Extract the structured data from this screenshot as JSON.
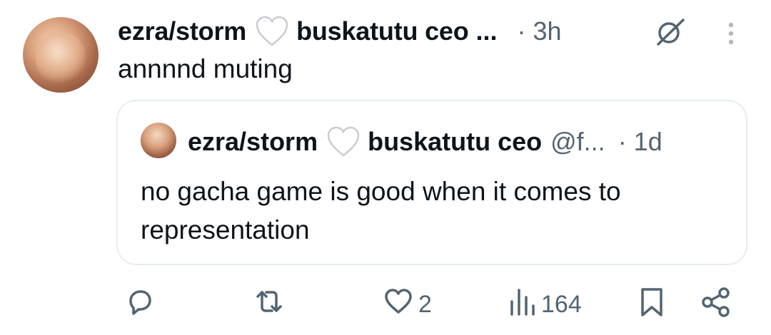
{
  "post": {
    "display_name": "ezra/storm",
    "name_suffix": "buskatutu ceo",
    "ellipsis": "...",
    "time": "· 3h",
    "text": "annnnd muting"
  },
  "quoted_post": {
    "display_name": "ezra/storm",
    "name_suffix": "buskatutu ceo",
    "handle": "@f...",
    "time": "· 1d",
    "text_line1": "no gacha game is good when it comes to",
    "text_line2": "representation"
  },
  "actions": {
    "reply_count": "",
    "repost_count": "",
    "like_count": "2",
    "views_count": "164"
  },
  "icons": {
    "heart_emoji": "white-heart-icon",
    "grok": "grok-icon",
    "more": "more-options-icon",
    "reply": "reply-icon",
    "repost": "repost-icon",
    "like": "like-icon",
    "views": "views-icon",
    "bookmark": "bookmark-icon",
    "share": "share-icon"
  },
  "colors": {
    "text": "#0f1419",
    "secondary": "#536471",
    "border": "#e6ecf0"
  }
}
